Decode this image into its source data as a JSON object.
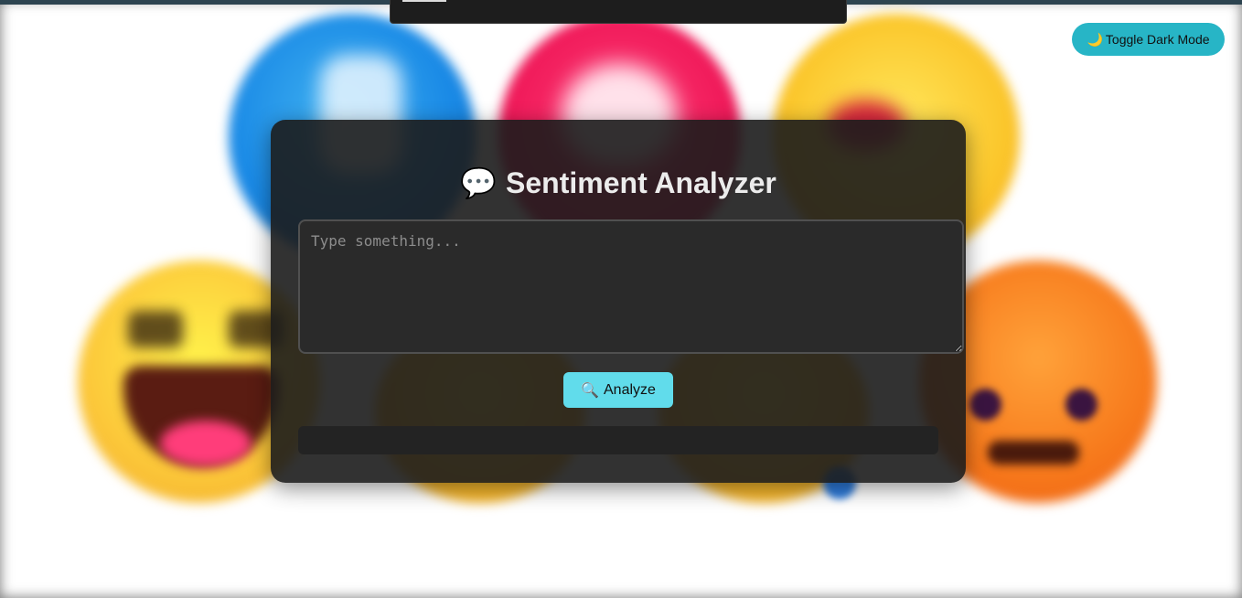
{
  "app": {
    "title": "Sentiment Analyzer",
    "title_icon": "💬"
  },
  "theme_toggle": {
    "icon": "🌙",
    "label": "Toggle Dark Mode"
  },
  "input": {
    "placeholder": "Type something...",
    "value": ""
  },
  "analyze_button": {
    "icon": "🔍",
    "label": "Analyze"
  },
  "result": {
    "text": ""
  },
  "colors": {
    "accent_toggle": "#27b5c6",
    "accent_button": "#61dceb",
    "card_background": "#1c1c1c"
  },
  "icons": {
    "title": "speech-bubble-icon",
    "toggle": "moon-icon",
    "analyze": "magnifier-icon"
  }
}
